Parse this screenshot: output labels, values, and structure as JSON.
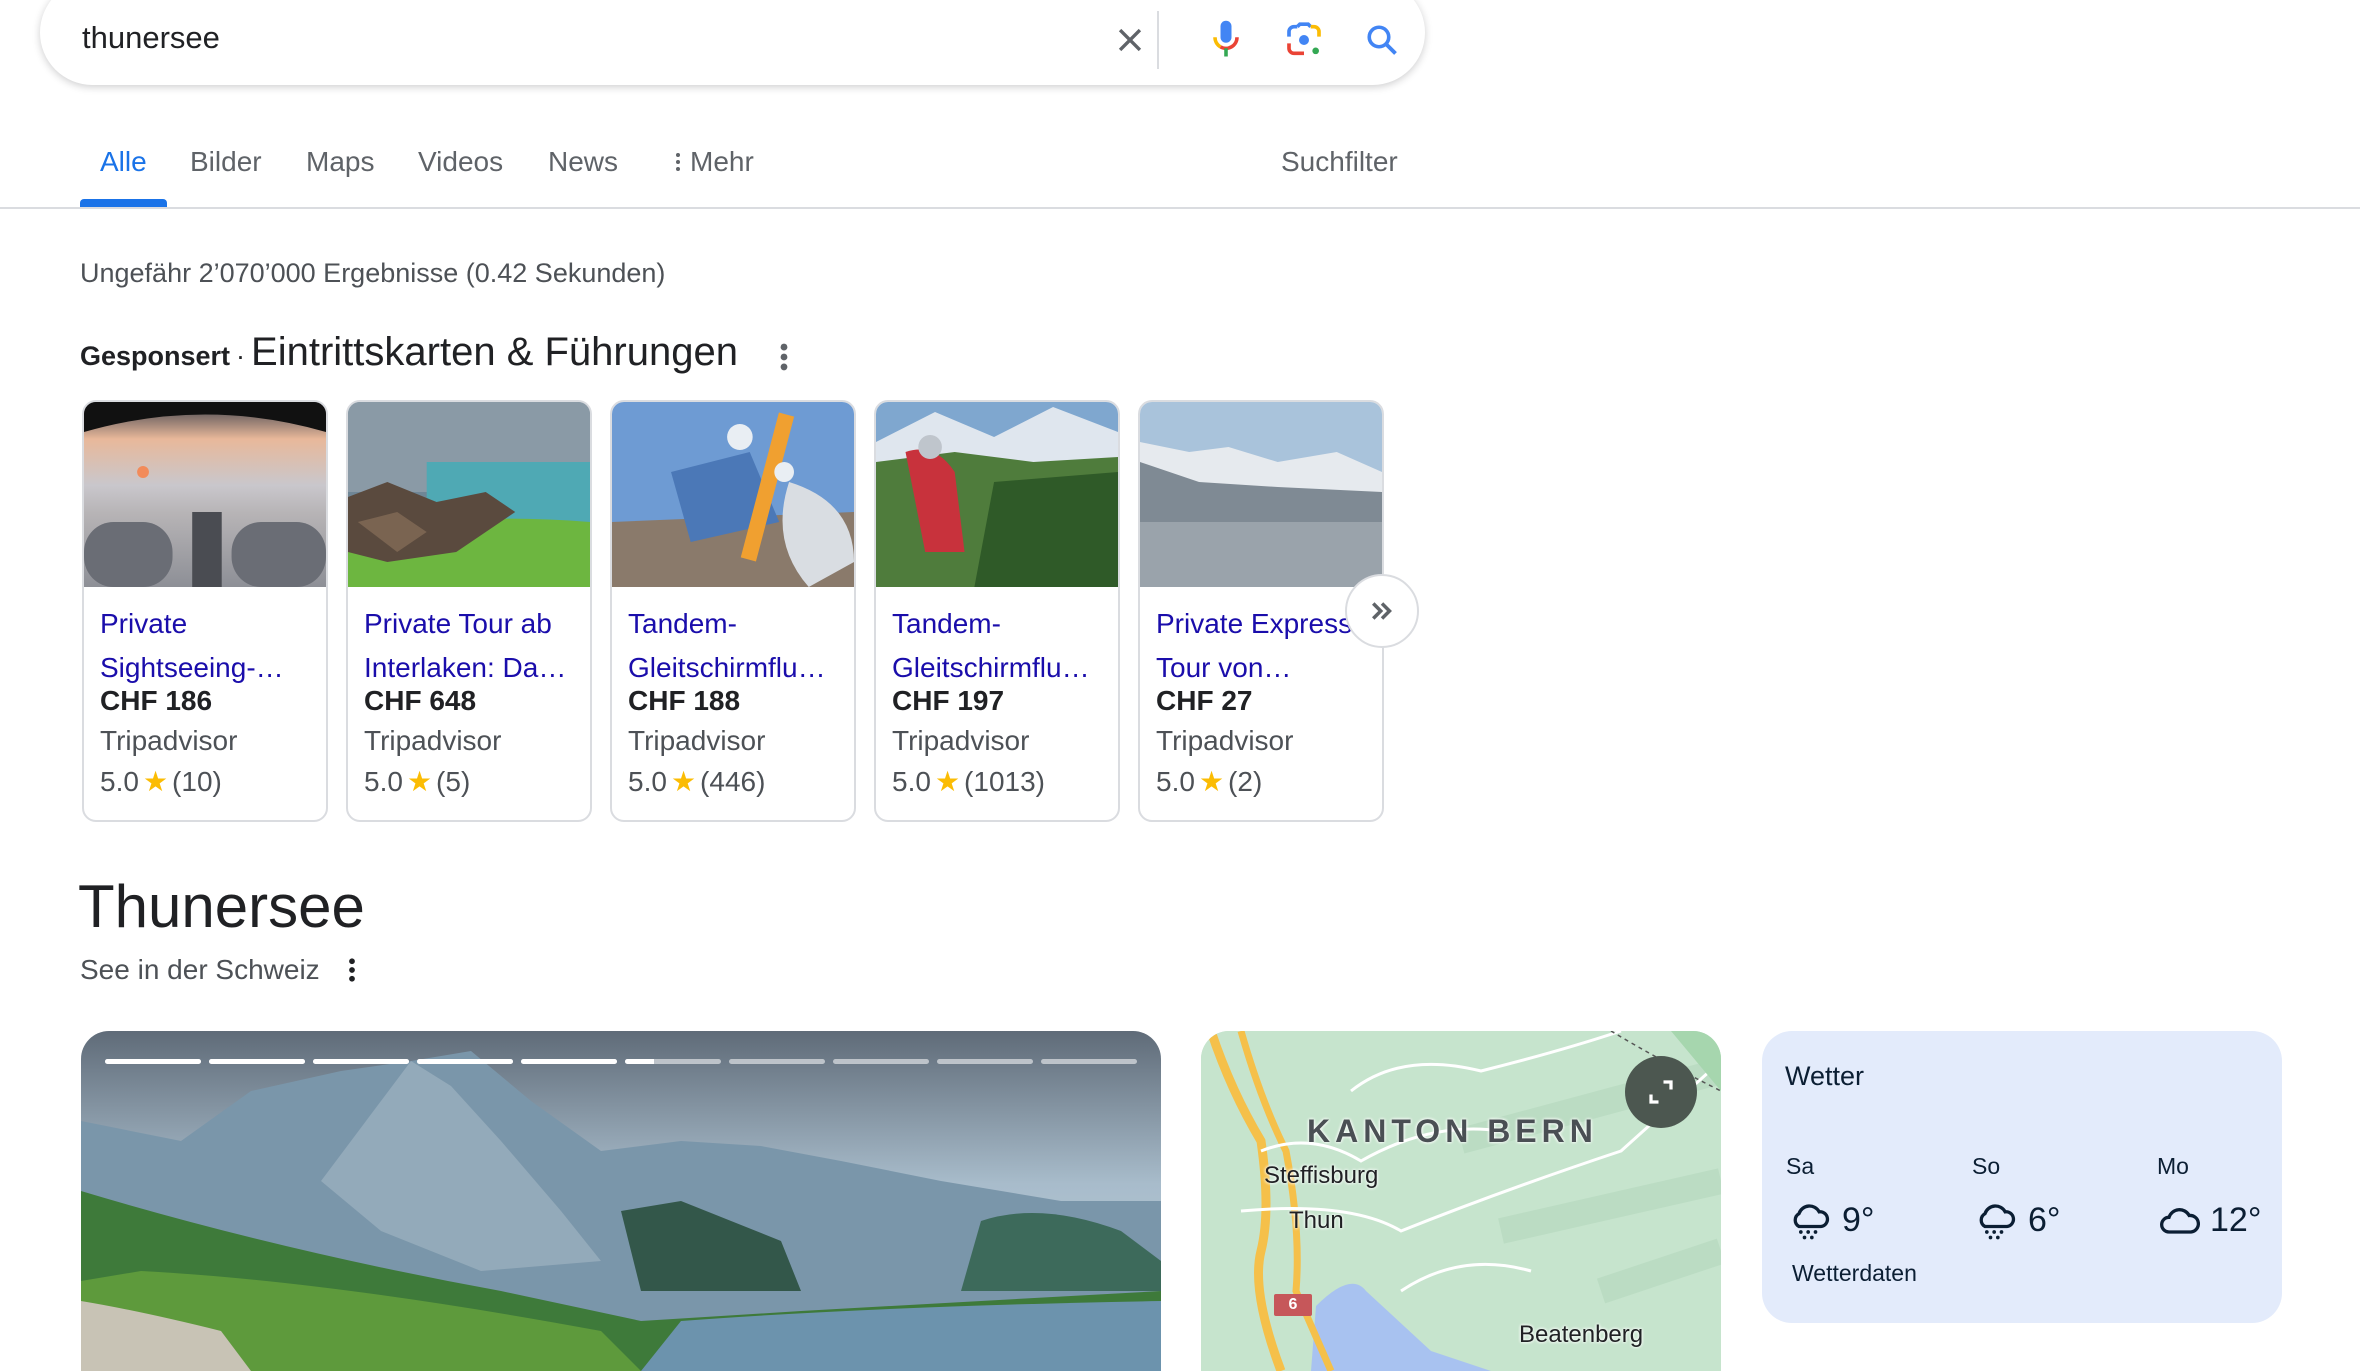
{
  "search": {
    "query": "thunersee",
    "clear_icon": "close-icon",
    "voice_icon": "microphone-icon",
    "lens_icon": "google-lens-icon",
    "search_icon": "search-icon"
  },
  "tabs": {
    "items": [
      {
        "label": "Alle",
        "active": true
      },
      {
        "label": "Bilder"
      },
      {
        "label": "Maps"
      },
      {
        "label": "Videos"
      },
      {
        "label": "News"
      },
      {
        "label": "Mehr"
      }
    ],
    "filter_label": "Suchfilter"
  },
  "result_stats": "Ungefähr 2’070’000 Ergebnisse (0.42 Sekunden)",
  "sponsored": {
    "label": "Gesponsert",
    "separator": "·",
    "title": "Eintrittskarten & Führungen",
    "cards": [
      {
        "title": "Private Sightseeing-…",
        "price": "CHF 186",
        "source": "Tripadvisor",
        "rating": "5.0",
        "reviews": "(10)"
      },
      {
        "title": "Private Tour ab Interlaken: Da…",
        "price": "CHF 648",
        "source": "Tripadvisor",
        "rating": "5.0",
        "reviews": "(5)"
      },
      {
        "title": "Tandem-Gleitschirmflu…",
        "price": "CHF 188",
        "source": "Tripadvisor",
        "rating": "5.0",
        "reviews": "(446)"
      },
      {
        "title": "Tandem-Gleitschirmflu…",
        "price": "CHF 197",
        "source": "Tripadvisor",
        "rating": "5.0",
        "reviews": "(1013)"
      },
      {
        "title": "Private Express Tour von…",
        "price": "CHF 27",
        "source": "Tripadvisor",
        "rating": "5.0",
        "reviews": "(2)"
      }
    ],
    "next_label": "»"
  },
  "knowledge_panel": {
    "title": "Thunersee",
    "subtitle": "See in der Schweiz",
    "image_carousel": {
      "total_slides": 10,
      "completed_slides": 5,
      "current_slide_progress": 0.3
    },
    "map": {
      "region_label": "KANTON BERN",
      "places": [
        "Steffisburg",
        "Thun",
        "Beatenberg"
      ],
      "road_shield": "6"
    },
    "weather": {
      "title": "Wetter",
      "days": [
        {
          "day": "Sa",
          "icon": "snow-cloud-icon",
          "temp": "9°"
        },
        {
          "day": "So",
          "icon": "snow-cloud-icon",
          "temp": "6°"
        },
        {
          "day": "Mo",
          "icon": "cloud-icon",
          "temp": "12°"
        }
      ],
      "link": "Wetterdaten"
    }
  }
}
